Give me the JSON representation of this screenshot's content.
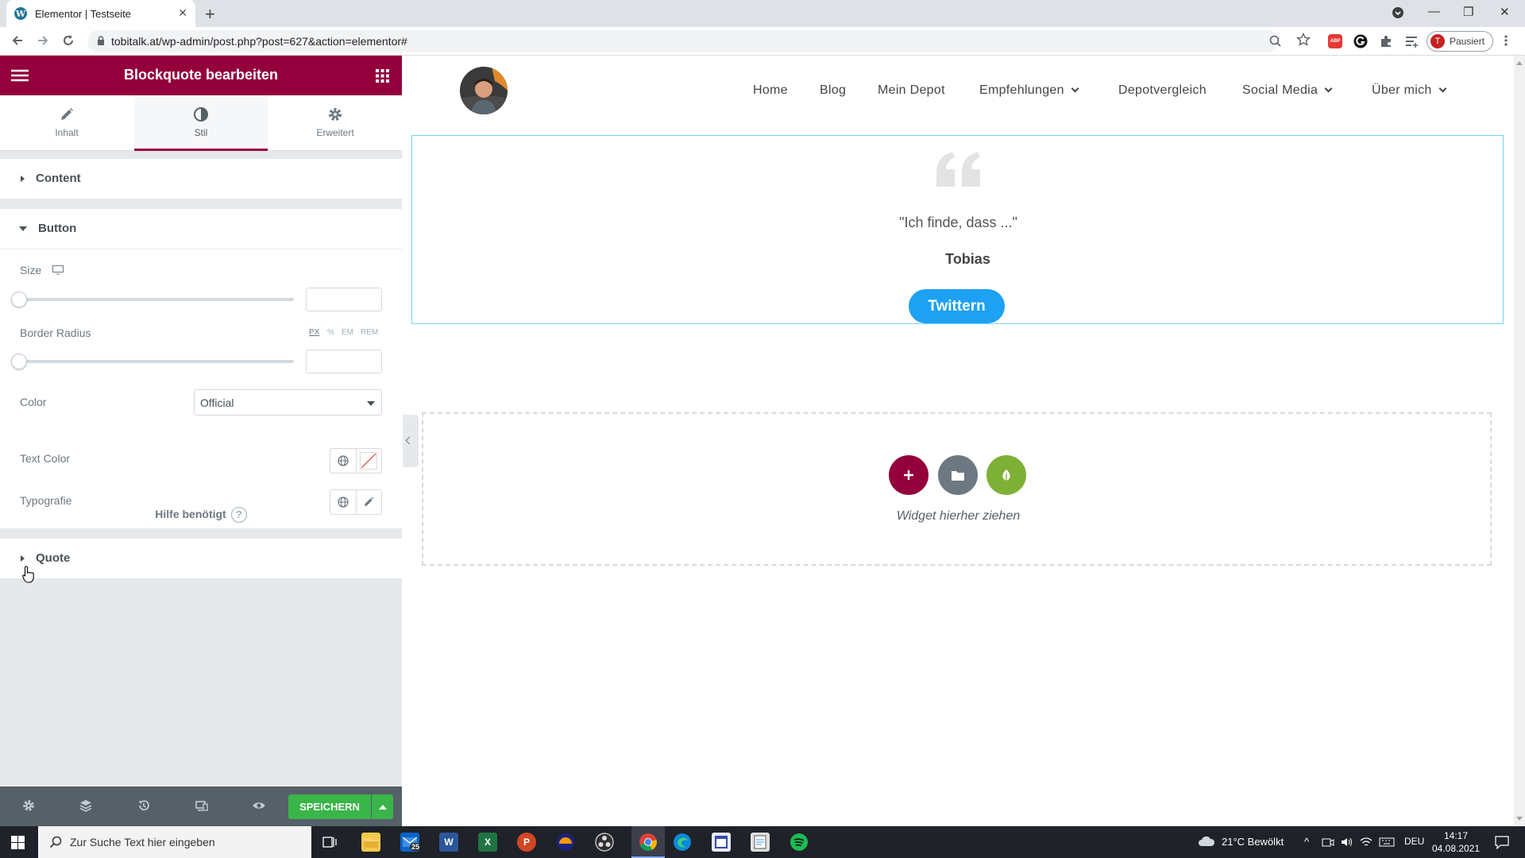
{
  "browser": {
    "tab_title": "Elementor | Testseite",
    "favicon_letter": "W",
    "url": "tobitalk.at/wp-admin/post.php?post=627&action=elementor#",
    "profile_letter": "T",
    "profile_status": "Pausiert",
    "abp_label": "ABP"
  },
  "panel": {
    "title": "Blockquote bearbeiten",
    "tabs": [
      {
        "label": "Inhalt"
      },
      {
        "label": "Stil"
      },
      {
        "label": "Erweitert"
      }
    ],
    "active_tab": "Stil",
    "sections": {
      "content": "Content",
      "button": "Button",
      "quote": "Quote"
    },
    "controls": {
      "size_label": "Size",
      "border_radius_label": "Border Radius",
      "units": [
        "PX",
        "%",
        "EM",
        "REM"
      ],
      "active_unit": "PX",
      "color_label": "Color",
      "color_value": "Official",
      "text_color_label": "Text Color",
      "typography_label": "Typografie"
    },
    "help": "Hilfe benötigt",
    "help_q": "?",
    "save_label": "SPEICHERN"
  },
  "preview": {
    "nav": [
      {
        "label": "Home"
      },
      {
        "label": "Blog"
      },
      {
        "label": "Mein Depot"
      },
      {
        "label": "Empfehlungen"
      },
      {
        "label": "Depotvergleich"
      },
      {
        "label": "Social Media"
      },
      {
        "label": "Über mich"
      }
    ],
    "quote_text": "\"Ich finde, dass ...\"",
    "quote_author": "Tobias",
    "tweet_label": "Twittern",
    "drop_text": "Widget hierher ziehen"
  },
  "taskbar": {
    "search_placeholder": "Zur Suche Text hier eingeben",
    "mail_badge": "25",
    "weather": "21°C  Bewölkt",
    "lang": "DEU",
    "time": "14:17",
    "date": "04.08.2021"
  },
  "colors": {
    "elementor_primary": "#93003c",
    "save_green": "#39b54a",
    "twitter_blue": "#1da1f2",
    "selection_border": "#71d7f7",
    "template_green": "#7eb036"
  }
}
